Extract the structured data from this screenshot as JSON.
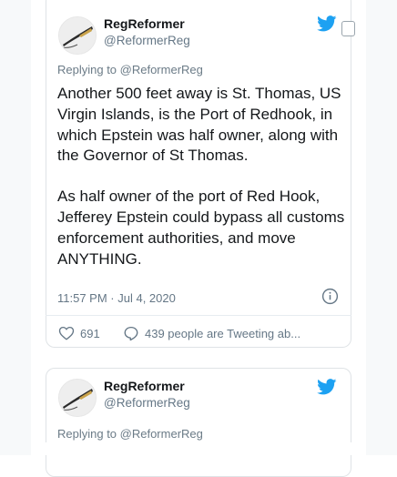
{
  "tweet1": {
    "display_name": "RegReformer",
    "handle": "@ReformerReg",
    "replying_to": "Replying to @ReformerReg",
    "paragraph1": "Another 500 feet away is St. Thomas, US Virgin Islands, is the Port of Redhook, in which Epstein was half owner, along with the Governor of St Thomas.",
    "paragraph2": "As half owner of the port of Red Hook, Jefferey Epstein could bypass all customs enforcement authorities, and move ANYTHING.",
    "timestamp": "11:57 PM · Jul 4, 2020",
    "like_count": "691",
    "conversation_text": "439 people are Tweeting ab..."
  },
  "tweet2": {
    "display_name": "RegReformer",
    "handle": "@ReformerReg",
    "replying_to": "Replying to @ReformerReg"
  },
  "icons": {
    "brand": "twitter-bird-icon",
    "like": "heart-icon",
    "conversation": "speech-bubble-icon",
    "info": "info-icon"
  },
  "colors": {
    "twitter_blue": "#1da1f2",
    "text": "#14171a",
    "secondary_text": "#657786",
    "border": "#dfe3e6"
  }
}
